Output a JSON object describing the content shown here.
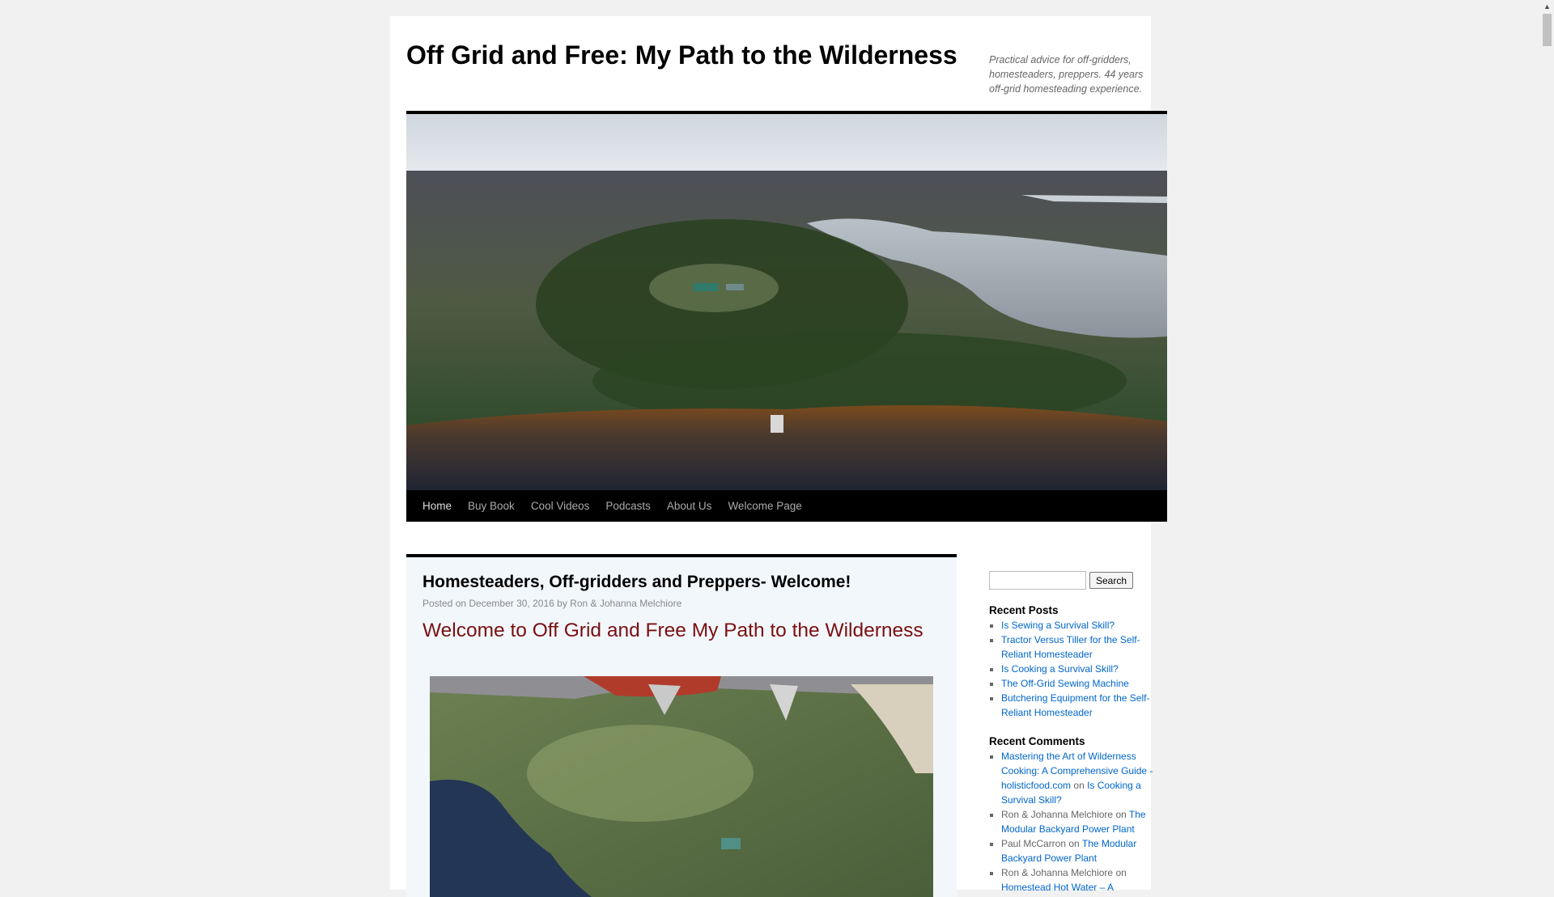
{
  "site": {
    "title": "Off Grid and Free: My Path to the Wilderness",
    "description": "Practical advice for off-gridders, homesteaders, preppers. 44 years off-grid homesteading experience."
  },
  "nav": {
    "items": [
      {
        "label": "Home"
      },
      {
        "label": "Buy Book"
      },
      {
        "label": "Cool Videos"
      },
      {
        "label": "Podcasts"
      },
      {
        "label": "About Us"
      },
      {
        "label": "Welcome Page"
      }
    ]
  },
  "post": {
    "title": "Homesteaders, Off-gridders and Preppers- Welcome!",
    "meta_prefix": "Posted on",
    "date": "December 30, 2016",
    "meta_by": "by",
    "author": "Ron & Johanna Melchiore",
    "welcome_heading": "Welcome to Off Grid and Free My Path to the Wilderness"
  },
  "sidebar": {
    "search": {
      "placeholder": "",
      "button_label": "Search"
    },
    "recent_posts": {
      "title": "Recent Posts",
      "items": [
        "Is Sewing a Survival Skill?",
        "Tractor Versus Tiller for the Self-Reliant Homesteader",
        "Is Cooking a Survival Skill?",
        "The Off-Grid Sewing Machine",
        "Butchering Equipment for the Self-Reliant Homesteader"
      ]
    },
    "recent_comments": {
      "title": "Recent Comments",
      "on": "on",
      "items": [
        {
          "author": "Mastering the Art of Wilderness Cooking: A Comprehensive Guide - holisticfood.com",
          "post": "Is Cooking a Survival Skill?"
        },
        {
          "author": "Ron & Johanna Melchiore",
          "post": "The Modular Backyard Power Plant"
        },
        {
          "author": "Paul McCarron",
          "post": "The Modular Backyard Power Plant"
        },
        {
          "author": "Ron & Johanna Melchiore",
          "post": "Homestead Hot Water – A"
        }
      ]
    }
  },
  "scrollbar": {
    "up_arrow": "▲"
  },
  "colors": {
    "page_bg": "#f1f1f1",
    "nav_bg": "#000000",
    "link": "#0066cc",
    "post_bg": "#f2f7fc",
    "welcome_heading": "#7a1010"
  }
}
